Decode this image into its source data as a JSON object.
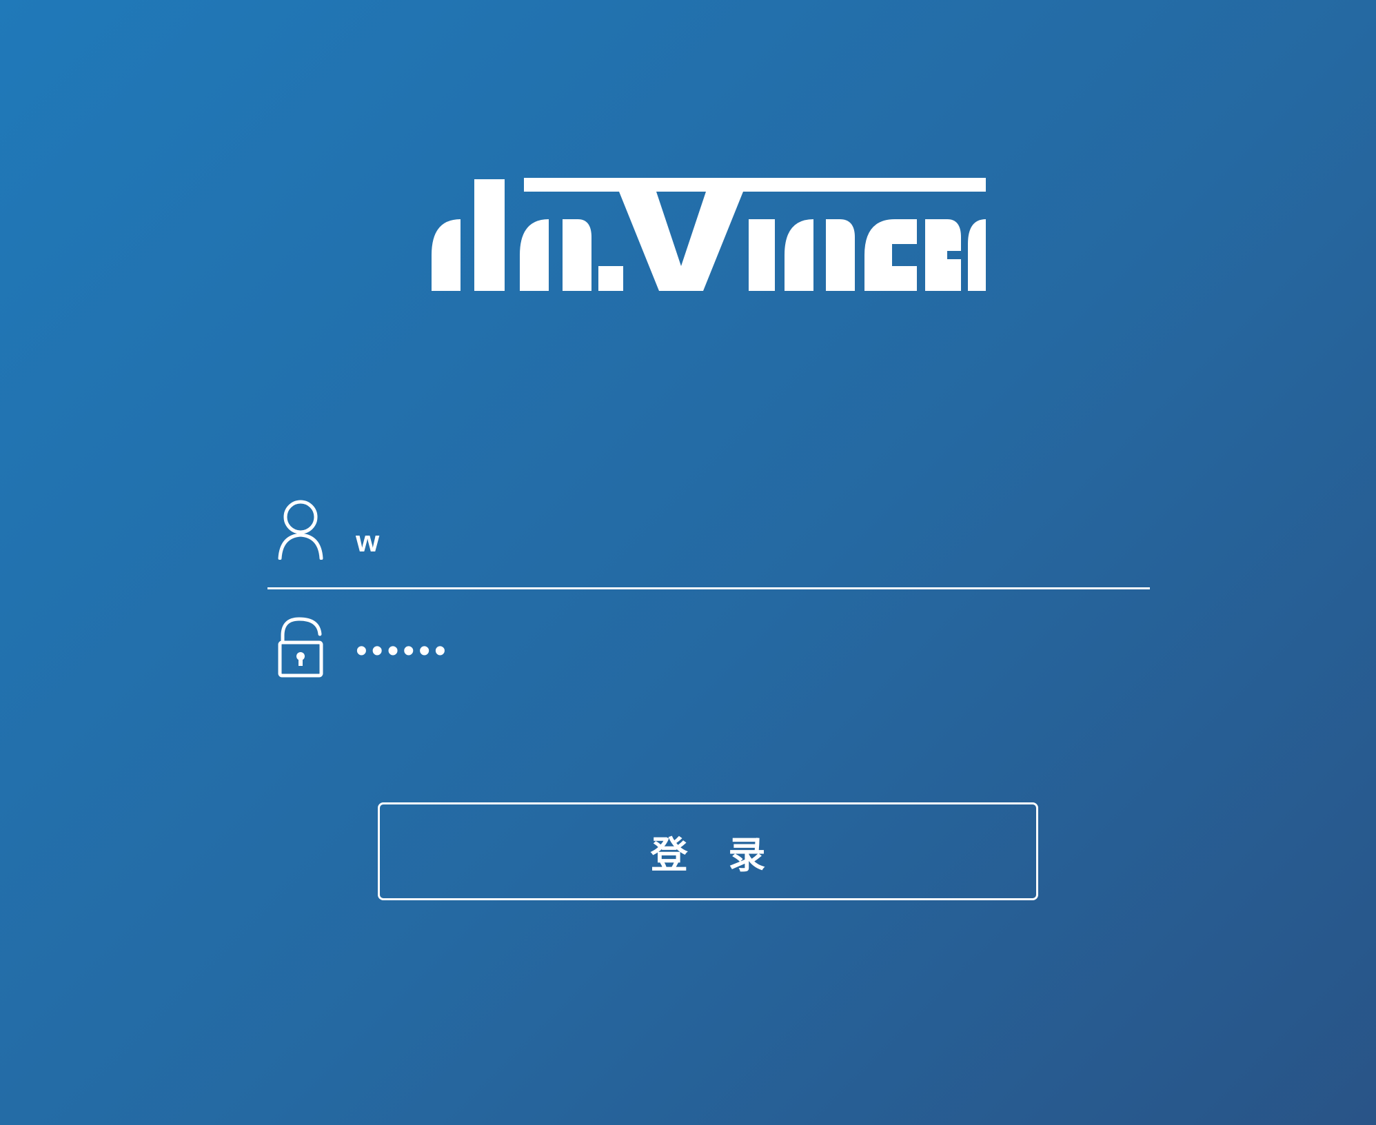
{
  "brand": {
    "logo_text": "daVinci"
  },
  "login_form": {
    "username_icon": "user-icon",
    "username_value": "w",
    "password_icon": "unlock-icon",
    "password_value": "••••••",
    "submit_label": "登 录"
  },
  "colors": {
    "background_start": "#2079b9",
    "background_end": "#295487",
    "foreground": "#ffffff"
  }
}
